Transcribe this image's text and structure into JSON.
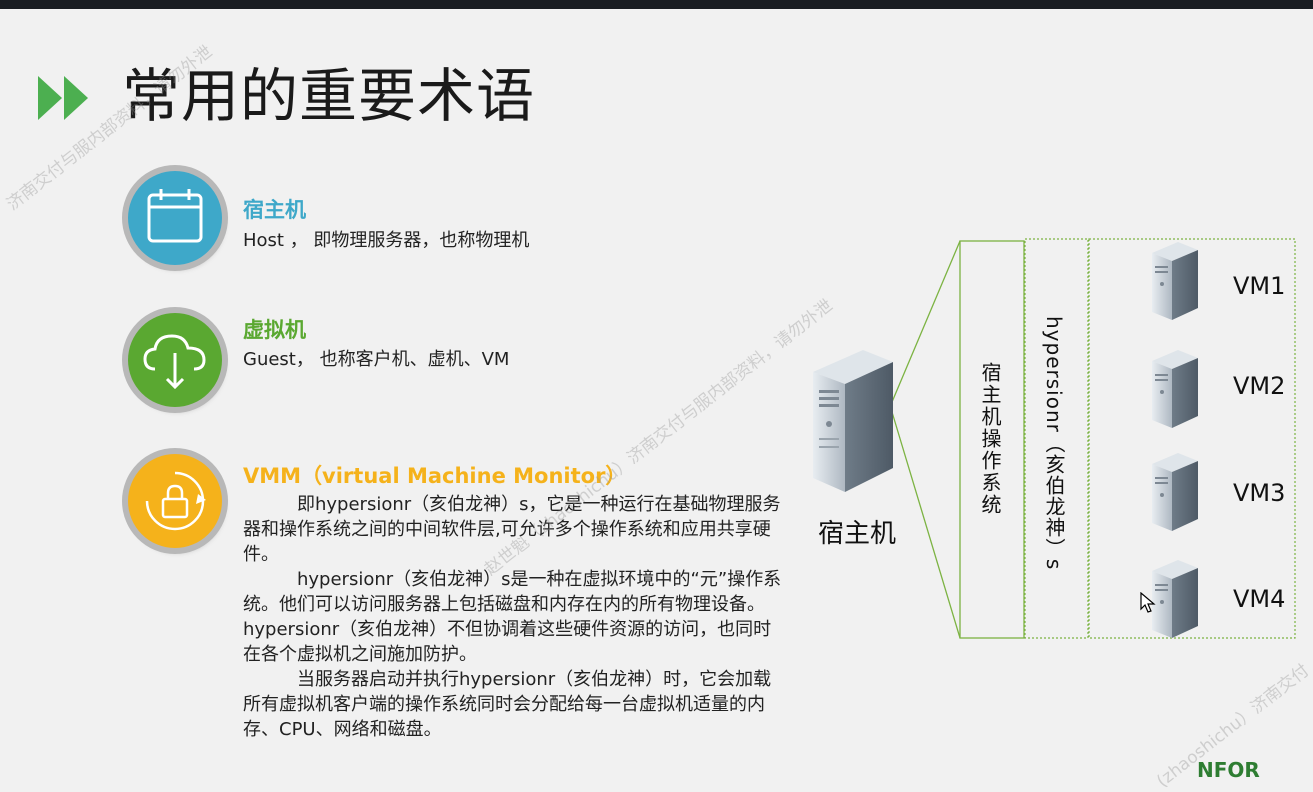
{
  "slide": {
    "title": "常用的重要术语"
  },
  "terms": [
    {
      "title": "宿主机",
      "desc": "Host ， 即物理服务器，也称物理机",
      "color": "#3ea8c9",
      "icon": "calendar-icon"
    },
    {
      "title": "虚拟机",
      "desc": "Guest， 也称客户机、虚机、VM",
      "color": "#5aa831",
      "icon": "cloud-download-icon"
    },
    {
      "title": "VMM（virtual Machine Monitor）",
      "color": "#f5b21b",
      "icon": "lock-refresh-icon"
    }
  ],
  "vmm_paragraphs": [
    "即hypersionr（亥伯龙神）s，它是一种运行在基础物理服务器和操作系统之间的中间软件层,可允许多个操作系统和应用共享硬件。",
    "hypersionr（亥伯龙神）s是一种在虚拟环境中的“元”操作系统。他们可以访问服务器上包括磁盘和内存在内的所有物理设备。hypersionr（亥伯龙神）不但协调着这些硬件资源的访问，也同时在各个虚拟机之间施加防护。",
    "当服务器启动并执行hypersionr（亥伯龙神）时，它会加载所有虚拟机客户端的操作系统同时会分配给每一台虚拟机适量的内存、CPU、网络和磁盘。"
  ],
  "diagram": {
    "host_label": "宿主机",
    "host_os_label": "宿主机操作系统",
    "hypervisor_label": "hypersionr（亥伯龙神）s",
    "vms": [
      "VM1",
      "VM2",
      "VM3",
      "VM4"
    ],
    "line_color": "#7cb342"
  },
  "watermarks": [
    "济南交付与服内部资料，请勿外泄",
    "赵世魁（zhaoshichu）济南交付与服内部资料，请勿外泄",
    "(zhaoshichu）济南交付"
  ],
  "logo_text": "NFOR"
}
